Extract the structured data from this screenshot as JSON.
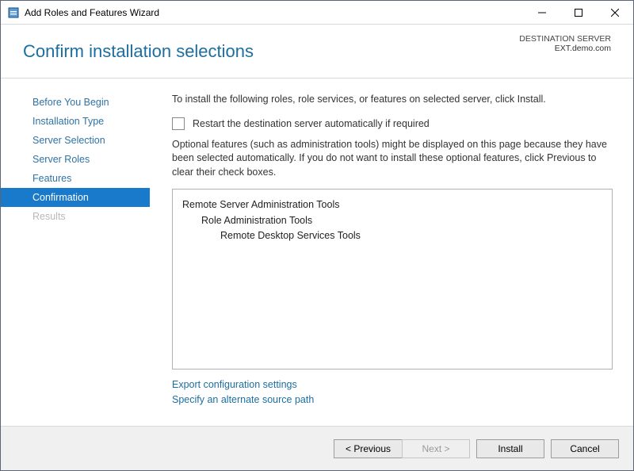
{
  "title": "Add Roles and Features Wizard",
  "banner": {
    "heading": "Confirm installation selections",
    "destination_label": "DESTINATION SERVER",
    "destination_server": "EXT.demo.com"
  },
  "nav": {
    "before_you_begin": "Before You Begin",
    "installation_type": "Installation Type",
    "server_selection": "Server Selection",
    "server_roles": "Server Roles",
    "features": "Features",
    "confirmation": "Confirmation",
    "results": "Results"
  },
  "main": {
    "instruction": "To install the following roles, role services, or features on selected server, click Install.",
    "checkbox_label": "Restart the destination server automatically if required",
    "optional_text": "Optional features (such as administration tools) might be displayed on this page because they have been selected automatically. If you do not want to install these optional features, click Previous to clear their check boxes.",
    "tree": {
      "root": "Remote Server Administration Tools",
      "level1": "Role Administration Tools",
      "level2": "Remote Desktop Services Tools"
    },
    "links": {
      "export": "Export configuration settings",
      "alt_source": "Specify an alternate source path"
    }
  },
  "footer": {
    "previous": "< Previous",
    "next": "Next >",
    "install": "Install",
    "cancel": "Cancel"
  }
}
